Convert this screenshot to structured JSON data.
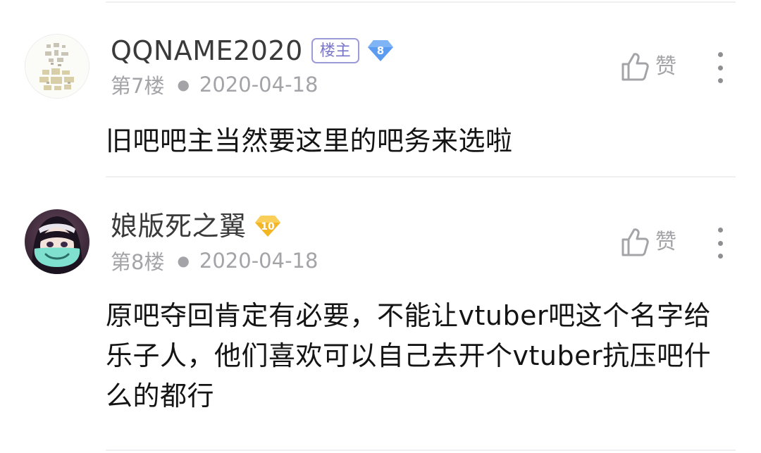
{
  "posts": [
    {
      "username": "QQNAME2020",
      "owner_badge": "楼主",
      "level": "8",
      "level_color": "#5b9bf0",
      "floor": "第7楼",
      "date": "2020-04-18",
      "like_label": "赞",
      "content": "旧吧吧主当然要这里的吧务来选啦"
    },
    {
      "username": "娘版死之翼",
      "level": "10",
      "level_color": "#f5b624",
      "floor": "第8楼",
      "date": "2020-04-18",
      "like_label": "赞",
      "content": "原吧夺回肯定有必要，不能让vtuber吧这个名字给乐子人，他们喜欢可以自己去开个vtuber抗压吧什么的都行"
    }
  ],
  "icons": {
    "like": "thumbs-up-icon",
    "more": "more-vertical-icon"
  }
}
